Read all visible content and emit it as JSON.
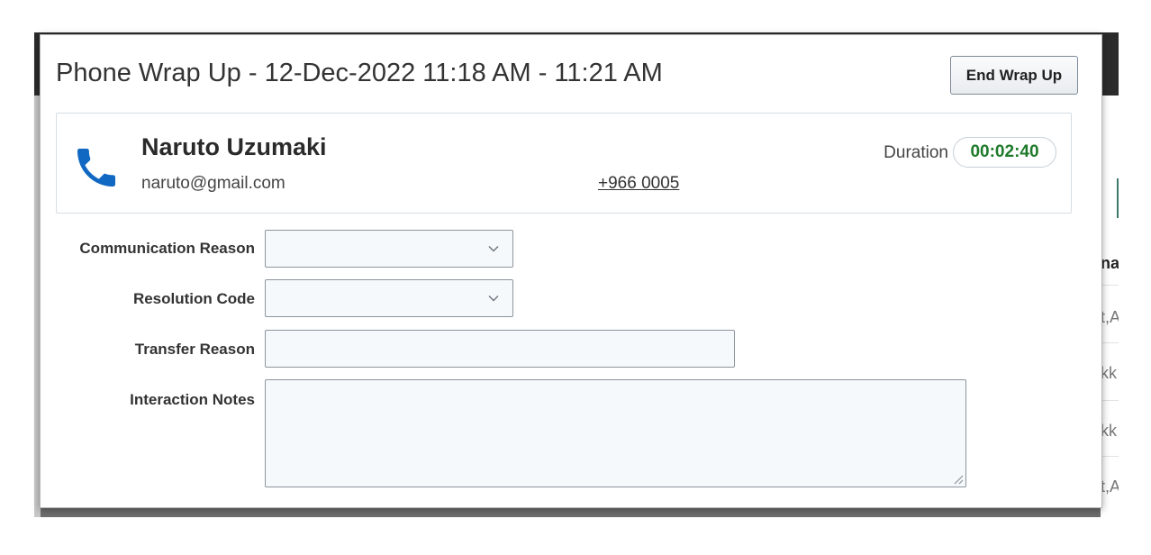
{
  "dialog": {
    "title": "Phone Wrap Up - 12-Dec-2022 11:18 AM - 11:21 AM",
    "end_button_label": "End Wrap Up"
  },
  "contact": {
    "name": "Naruto Uzumaki",
    "email": "naruto@gmail.com",
    "phone": "+966 0005",
    "duration_label": "Duration",
    "duration_value": "00:02:40",
    "icon": "phone-icon"
  },
  "form": {
    "communication_reason_label": "Communication Reason",
    "communication_reason_value": "",
    "resolution_code_label": "Resolution Code",
    "resolution_code_value": "",
    "transfer_reason_label": "Transfer Reason",
    "transfer_reason_value": "",
    "interaction_notes_label": "Interaction Notes",
    "interaction_notes_value": ""
  },
  "background": {
    "fragments": [
      "na",
      "t,A",
      "kk",
      "kk",
      "t,A"
    ]
  },
  "colors": {
    "phone_icon": "#1068c3",
    "duration_text": "#1e7a2a",
    "field_border": "#8c949d",
    "field_background": "#f6f9fb"
  }
}
